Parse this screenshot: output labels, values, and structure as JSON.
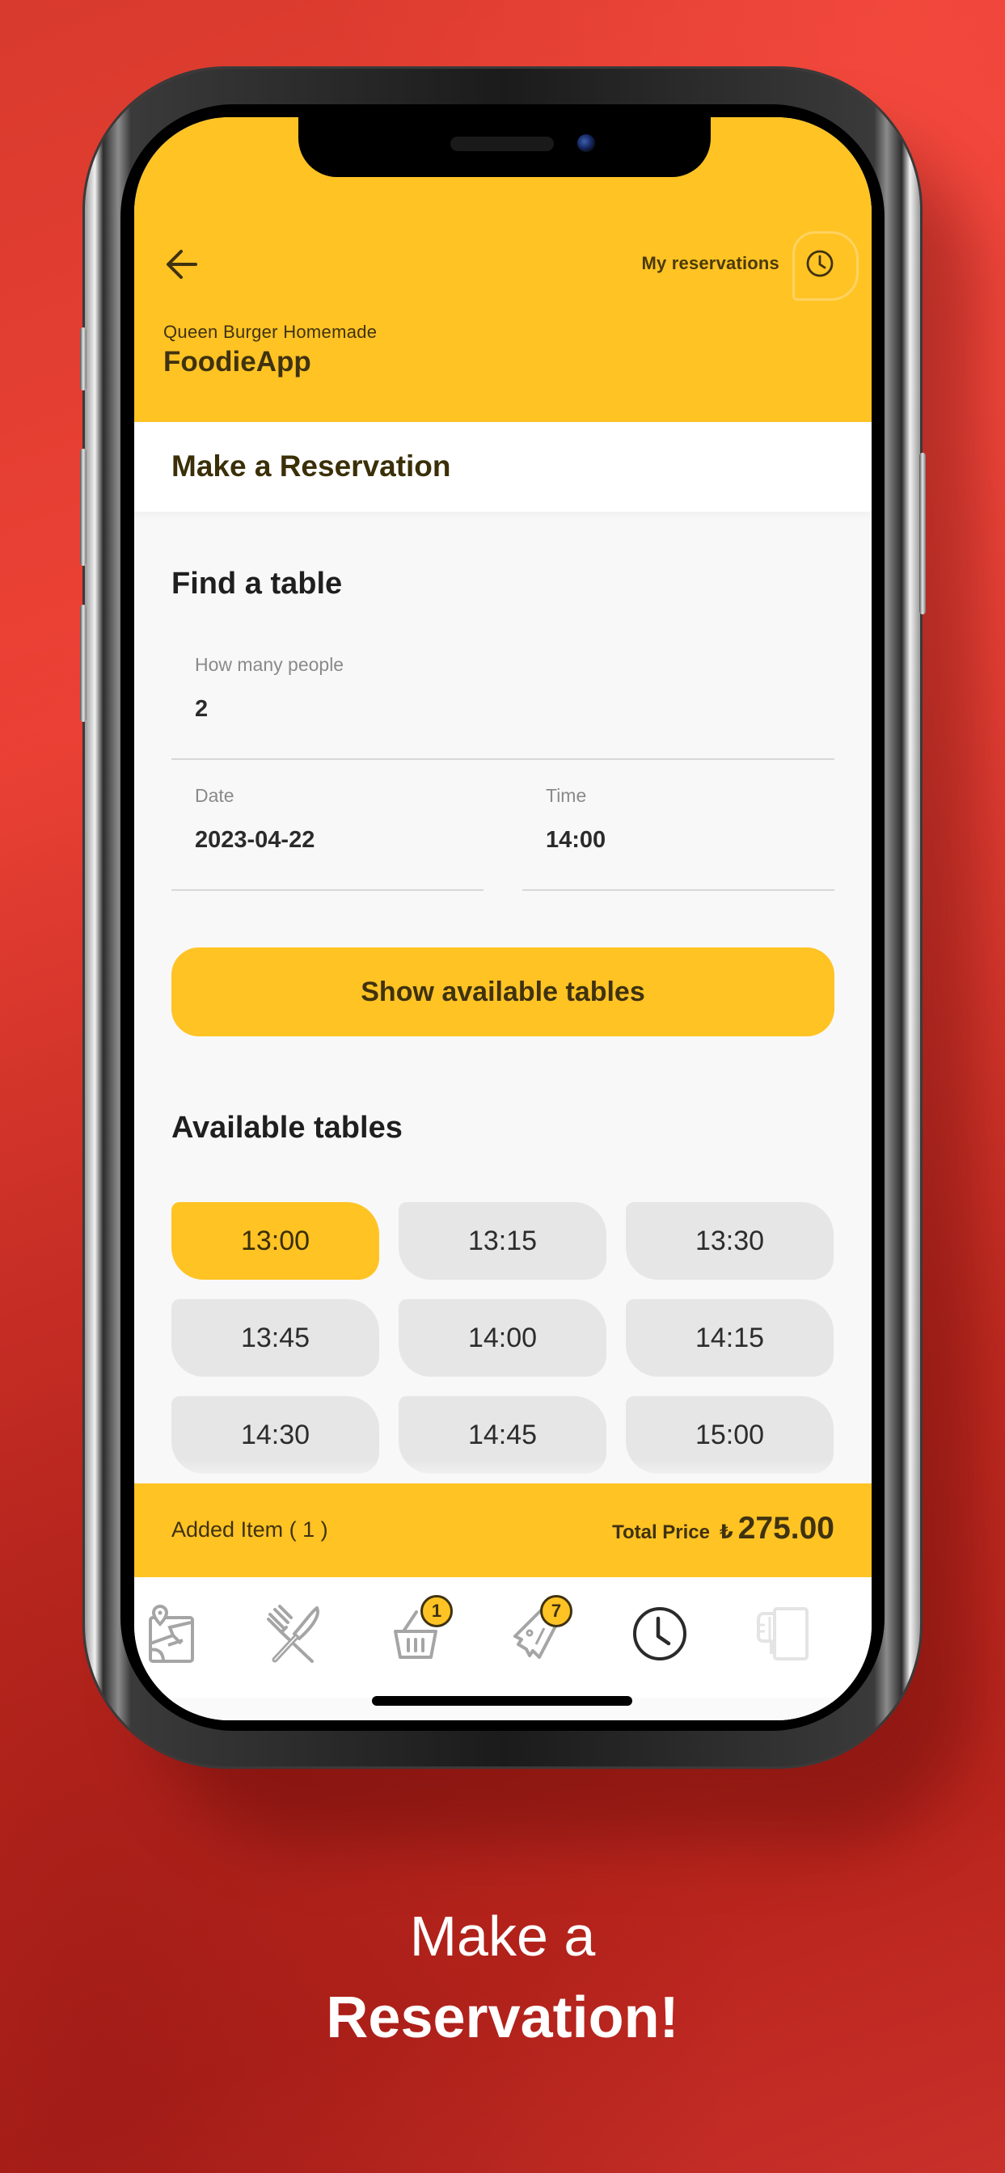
{
  "theme": {
    "accent": "#ffc324",
    "background_red": "#d8382c",
    "text_dark": "#3f3210"
  },
  "header": {
    "back_icon": "arrow-left-icon",
    "my_reservations_label": "My reservations",
    "my_reservations_icon": "clock-icon",
    "restaurant_name": "Queen Burger Homemade",
    "app_name": "FoodieApp"
  },
  "page_title": "Make a Reservation",
  "find_table": {
    "title": "Find a table",
    "people_label": "How many people",
    "people_value": "2",
    "date_label": "Date",
    "date_value": "2023-04-22",
    "time_label": "Time",
    "time_value": "14:00",
    "show_button_label": "Show available tables"
  },
  "available_tables": {
    "title": "Available tables",
    "selected": "13:00",
    "slots": [
      "13:00",
      "13:15",
      "13:30",
      "13:45",
      "14:00",
      "14:15",
      "14:30",
      "14:45",
      "15:00"
    ]
  },
  "cart_bar": {
    "added_item_label": "Added Item ( 1 )",
    "total_label": "Total Price",
    "currency_symbol": "₺",
    "total_value": "275.00"
  },
  "bottom_nav": {
    "items": [
      {
        "name": "map",
        "icon": "map-pin-icon"
      },
      {
        "name": "menu",
        "icon": "fork-knife-icon"
      },
      {
        "name": "basket",
        "icon": "basket-icon",
        "badge": "1"
      },
      {
        "name": "offers",
        "icon": "discount-tag-icon",
        "badge": "7"
      },
      {
        "name": "reservations",
        "icon": "clock-icon",
        "active": true
      },
      {
        "name": "logout",
        "icon": "exit-door-icon"
      }
    ]
  },
  "caption": {
    "line1": "Make a",
    "line2": "Reservation!"
  }
}
